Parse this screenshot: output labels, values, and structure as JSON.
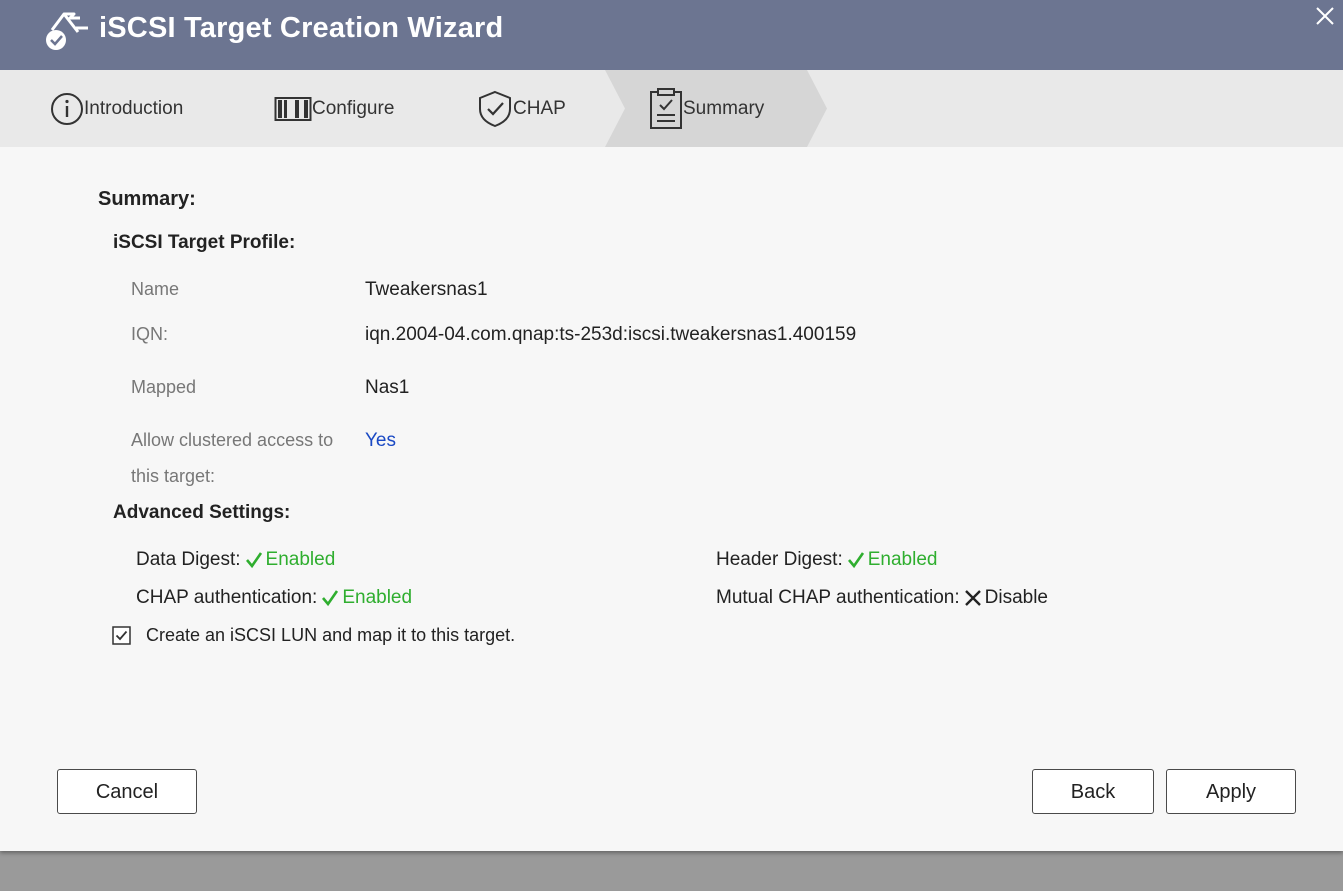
{
  "window": {
    "title": "iSCSI Target Creation Wizard"
  },
  "steps": [
    {
      "label": "Introduction",
      "icon": "info-icon"
    },
    {
      "label": "Configure",
      "icon": "drive-icon"
    },
    {
      "label": "CHAP",
      "icon": "shield-check-icon"
    },
    {
      "label": "Summary",
      "icon": "clipboard-check-icon",
      "active": true
    }
  ],
  "summary": {
    "heading": "Summary:",
    "profile_heading": "iSCSI Target Profile:",
    "fields": [
      {
        "label": "Name",
        "value": "Tweakersnas1"
      },
      {
        "label": "IQN:",
        "value": "iqn.2004-04.com.qnap:ts-253d:iscsi.tweakersnas1.400159"
      },
      {
        "label": "Mapped",
        "value": "Nas1"
      },
      {
        "label_line1": "Allow clustered access to",
        "label_line2": "this target:",
        "value": "Yes"
      }
    ],
    "advanced_heading": "Advanced Settings:",
    "advanced": {
      "data_digest": {
        "label": "Data Digest:",
        "status": "Enabled"
      },
      "header_digest": {
        "label": "Header Digest:",
        "status": "Enabled"
      },
      "chap_auth": {
        "label": "CHAP authentication:",
        "status": "Enabled"
      },
      "mutual_chap": {
        "label": "Mutual CHAP authentication:",
        "status": "Disable"
      }
    },
    "create_lun_label": "Create an iSCSI LUN and map it to this target."
  },
  "buttons": {
    "cancel": "Cancel",
    "back": "Back",
    "apply": "Apply"
  },
  "colors": {
    "titlebar": "#6c7591",
    "enabled": "#2fae2f",
    "yes": "#1a49c4",
    "active_step": "#d6d6d6"
  }
}
